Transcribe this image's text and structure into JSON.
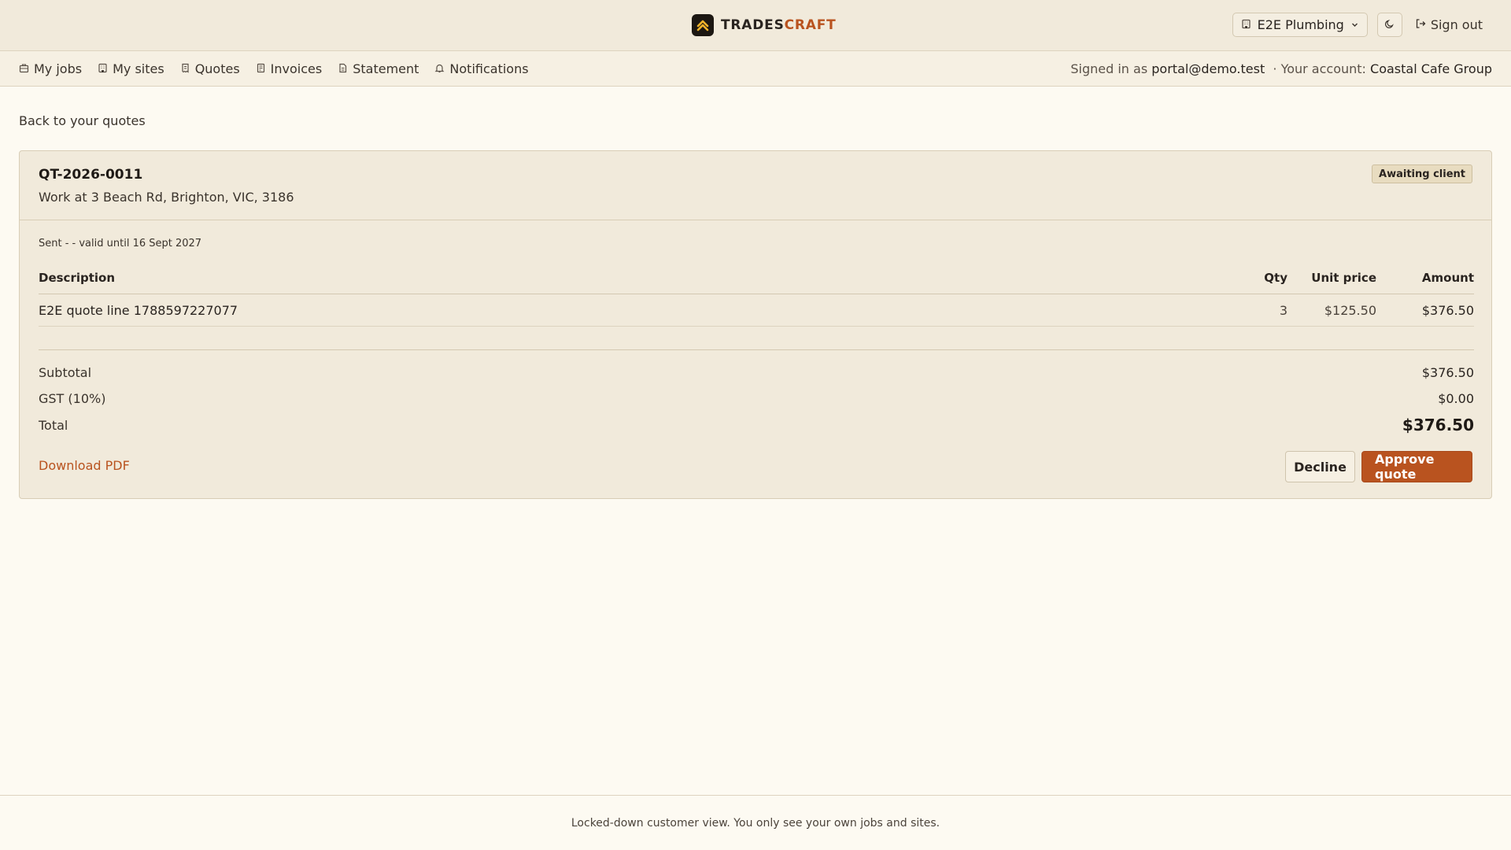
{
  "brand": {
    "name_part1": "TRADES",
    "name_part2": "CRAFT"
  },
  "header": {
    "org_selector": "E2E Plumbing",
    "theme_icon": "moon-icon",
    "sign_out": "Sign out"
  },
  "nav": {
    "items": [
      {
        "label": "My jobs",
        "icon": "briefcase-icon"
      },
      {
        "label": "My sites",
        "icon": "building-icon"
      },
      {
        "label": "Quotes",
        "icon": "receipt-icon"
      },
      {
        "label": "Invoices",
        "icon": "invoice-icon"
      },
      {
        "label": "Statement",
        "icon": "document-icon"
      },
      {
        "label": "Notifications",
        "icon": "bell-icon"
      }
    ],
    "signed_in_prefix": "Signed in as",
    "signed_in_email": "portal@demo.test",
    "account_prefix": "· Your account:",
    "account_name": "Coastal Cafe Group"
  },
  "back_link": "Back to your quotes",
  "quote": {
    "number": "QT-2026-0011",
    "address": "Work at 3 Beach Rd, Brighton, VIC, 3186",
    "status": "Awaiting client",
    "sent_line": "Sent - - valid until 16 Sept 2027",
    "columns": {
      "description": "Description",
      "qty": "Qty",
      "unit_price": "Unit price",
      "amount": "Amount"
    },
    "lines": [
      {
        "description": "E2E quote line 1788597227077",
        "qty": "3",
        "unit_price": "$125.50",
        "amount": "$376.50"
      }
    ],
    "subtotal_label": "Subtotal",
    "subtotal_value": "$376.50",
    "gst_label": "GST (10%)",
    "gst_value": "$0.00",
    "total_label": "Total",
    "total_value": "$376.50",
    "download_label": "Download PDF",
    "decline_label": "Decline",
    "approve_label": "Approve quote"
  },
  "footer": {
    "text": "Locked-down customer view. You only see your own jobs and sites."
  },
  "colors": {
    "accent": "#b9531f",
    "header_bg": "#f1eadb",
    "page_bg": "#fdfaf2"
  }
}
